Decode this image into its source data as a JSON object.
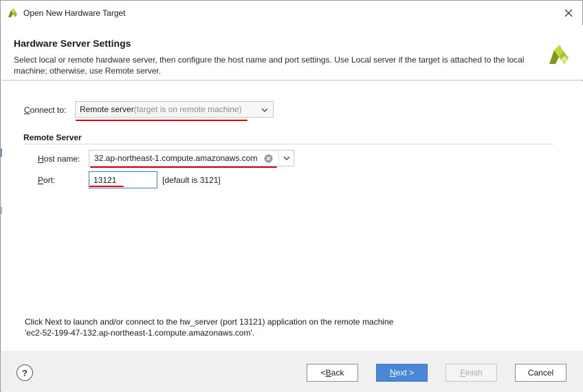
{
  "window": {
    "title": "Open New Hardware Target",
    "icon": "xilinx-logo-icon",
    "close_icon": "close-icon"
  },
  "header": {
    "title": "Hardware Server Settings",
    "description": "Select local or remote hardware server, then configure the host name and port settings. Use Local server if the target is attached to the local machine; otherwise, use Remote server.",
    "logo": "xilinx-logo-icon"
  },
  "connect_to": {
    "label_prefix": "C",
    "label_rest": "onnect to:",
    "selected_main": "Remote server",
    "selected_hint": " (target is on remote machine)"
  },
  "remote_server": {
    "section_title": "Remote Server",
    "host_label_prefix": "H",
    "host_label_rest": "ost name:",
    "host_value": "32.ap-northeast-1.compute.amazonaws.com",
    "port_label_prefix": "P",
    "port_label_rest": "ort:",
    "port_value": "13121",
    "port_default_hint": "[default is 3121]"
  },
  "message": {
    "line1": "Click Next to launch and/or connect to the hw_server (port 13121) application on the remote machine",
    "line2": "'ec2-52-199-47-132.ap-northeast-1.compute.amazonaws.com'."
  },
  "footer": {
    "help_label": "?",
    "back_prefix": "< ",
    "back_u": "B",
    "back_rest": "ack",
    "next_u": "N",
    "next_rest": "ext >",
    "finish_u": "F",
    "finish_rest": "inish",
    "cancel_label": "Cancel"
  },
  "colors": {
    "annotation_red": "#e00000",
    "primary_button": "#4a88d6",
    "focus_border": "#3c7fd4"
  }
}
